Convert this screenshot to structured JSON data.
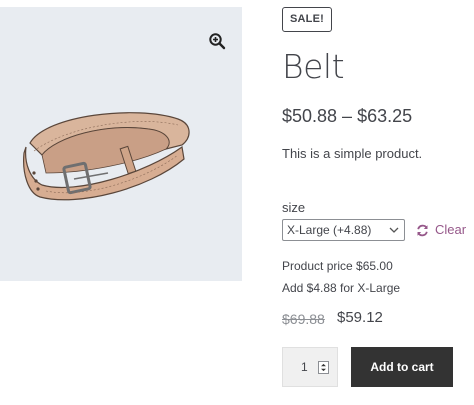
{
  "product": {
    "sale_badge": "SALE!",
    "title": "Belt",
    "price_range": "$50.88 – $63.25",
    "description": "This is a simple product."
  },
  "gallery": {
    "image_alt": "belt-image",
    "zoom_icon": "magnifier-plus-icon"
  },
  "variation": {
    "label": "size",
    "selected": "X-Large (+4.88)",
    "clear_label": "Clear",
    "clear_icon": "refresh-icon"
  },
  "addon": {
    "product_price": "Product price $65.00",
    "note": "Add $4.88 for X-Large"
  },
  "price": {
    "old": "$69.88",
    "new": "$59.12"
  },
  "cart": {
    "quantity": "1",
    "button_label": "Add to cart"
  },
  "colors": {
    "accent_link": "#96588a",
    "button_bg": "#333333",
    "gallery_bg": "#e8ecf1"
  }
}
